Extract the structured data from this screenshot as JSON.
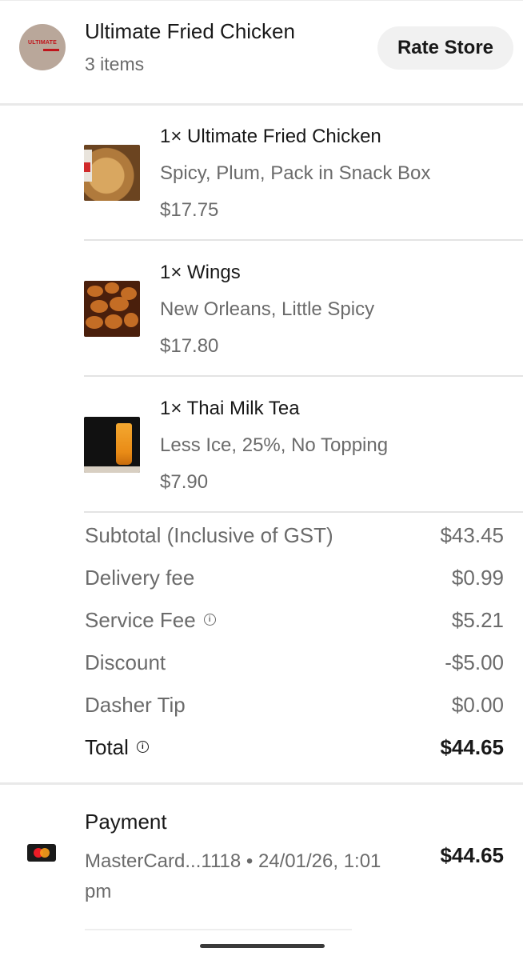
{
  "store": {
    "logo_text": "ULTIMATE",
    "name": "Ultimate Fried Chicken",
    "item_count": "3 items",
    "rate_button": "Rate Store"
  },
  "items": [
    {
      "title": "1× Ultimate Fried Chicken",
      "options": "Spicy, Plum, Pack in Snack Box",
      "price": "$17.75",
      "image": "fried-chicken-image"
    },
    {
      "title": "1× Wings",
      "options": "New Orleans, Little Spicy",
      "price": "$17.80",
      "image": "wings-image"
    },
    {
      "title": "1× Thai Milk Tea",
      "options": "Less Ice, 25%, No Topping",
      "price": "$7.90",
      "image": "thai-milk-tea-image"
    }
  ],
  "summary": {
    "subtotal_label": "Subtotal (Inclusive of GST)",
    "subtotal_value": "$43.45",
    "delivery_label": "Delivery fee",
    "delivery_value": "$0.99",
    "service_label": "Service Fee",
    "service_value": "$5.21",
    "discount_label": "Discount",
    "discount_value": "-$5.00",
    "tip_label": "Dasher Tip",
    "tip_value": "$0.00",
    "total_label": "Total",
    "total_value": "$44.65",
    "info_icon": "info-circle-icon"
  },
  "payment": {
    "title": "Payment",
    "card_icon": "mastercard-icon",
    "detail": "MasterCard...1118 • 24/01/26, 1:01 pm",
    "amount": "$44.65"
  },
  "colors": {
    "primary_text": "#191919",
    "secondary_text": "#6b6b6b",
    "button_bg": "#f1f1f1",
    "divider": "#e4e4e4"
  }
}
